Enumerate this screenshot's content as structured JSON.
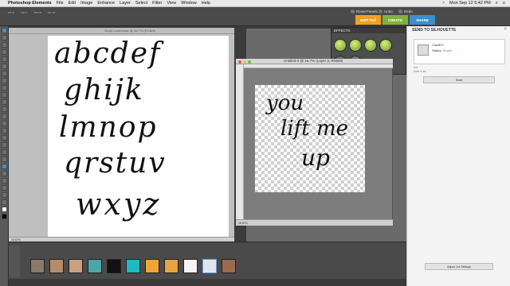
{
  "menubar": {
    "app": "Photoshop Elements",
    "items": [
      "File",
      "Edit",
      "Image",
      "Enhance",
      "Layer",
      "Select",
      "Filter",
      "View",
      "Window",
      "Help"
    ],
    "clock": "Mon Sep 12  5:42 PM"
  },
  "appbar": {
    "reset_panels": "Reset Panels",
    "undo": "Undo",
    "redo": "Redo",
    "mode_edit": "EDIT Full",
    "mode_create": "CREATE",
    "mode_share": "SHARE"
  },
  "effects_panel": {
    "title": "EFFECTS"
  },
  "document1": {
    "title": "Script Lowercase @ 16.7% (RGB/8)",
    "status": "16.67%",
    "letters": [
      "abcdef",
      "ghijk",
      "lmnop",
      "qrstuv",
      "wxyz"
    ]
  },
  "document2": {
    "title": "Untitled-2 @ 16.7% (Layer 3, RGB/8)",
    "status": "16.67%",
    "canvas_text": [
      "you",
      "lift me",
      "up"
    ]
  },
  "silhouette": {
    "title": "SEND TO SILHOUETTE",
    "device_name": "CAMEO",
    "device_status_label": "Status:",
    "device_status": "Ready",
    "start_label": "Start",
    "adjust_label": "Adjust Cut Settings"
  },
  "colors": {
    "create": "#7fb23a",
    "edit": "#f0a020",
    "share": "#3a8fd0"
  }
}
